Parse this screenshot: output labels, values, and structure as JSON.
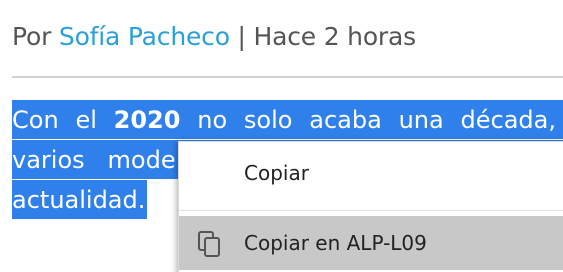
{
  "byline": {
    "prefix": "Por",
    "author": "Sofía Pacheco",
    "separator": "|",
    "time": "Hace 2 horas"
  },
  "article": {
    "line1": {
      "w1": "Con",
      "w2": "el",
      "w3": "2020",
      "w4": "no",
      "w5": "solo",
      "w6": "acaba",
      "w7": "una",
      "w8": "década,"
    },
    "line2": {
      "w1": "varios",
      "w2": "mode"
    },
    "line3": {
      "w1": "actualidad."
    }
  },
  "context_menu": {
    "copy_label": "Copiar",
    "copy_to_device_label": "Copiar en ALP-L09",
    "copy_to_device_icon": "copy-icon"
  },
  "colors": {
    "selection": "#2f80ea",
    "author_link": "#2c9fd9",
    "hover_item": "#c8c8c8"
  }
}
